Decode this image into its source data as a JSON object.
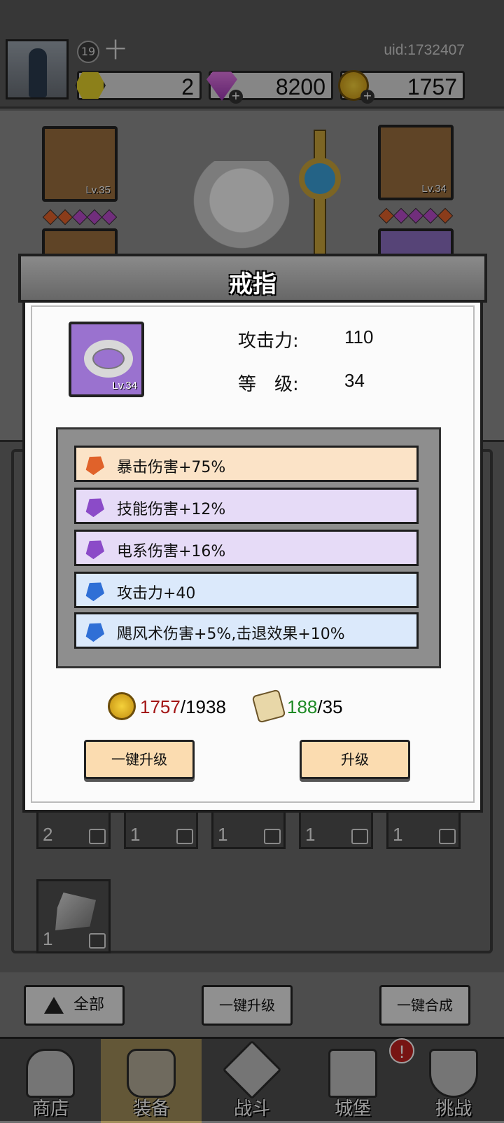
{
  "header": {
    "level": "19",
    "level_plus": "十",
    "uid": "uid:1732407",
    "resources": [
      {
        "icon": "hexagon-token-icon",
        "value": "2"
      },
      {
        "icon": "diamond-gem-icon",
        "value": "8200"
      },
      {
        "icon": "gold-coin-icon",
        "value": "1757"
      }
    ]
  },
  "equipment": {
    "left_slot_level": "Lv.35",
    "right_slot_level": "Lv.34"
  },
  "dialog": {
    "title": "戒指",
    "item_level": "Lv.34",
    "stats": [
      {
        "label": "攻击力:",
        "value": "110"
      },
      {
        "label": "等　级:",
        "value": "34"
      }
    ],
    "affixes": [
      {
        "text": "暴击伤害+75%",
        "gem_color": "#e0622a",
        "bg": "#fbe3c7"
      },
      {
        "text": "技能伤害+12%",
        "gem_color": "#8b4bc8",
        "bg": "#e6dbf7"
      },
      {
        "text": "电系伤害+16%",
        "gem_color": "#8b4bc8",
        "bg": "#e6dbf7"
      },
      {
        "text": "攻击力+40",
        "gem_color": "#2f6fd6",
        "bg": "#dbe9fb"
      },
      {
        "text": "飓风术伤害+5%,击退效果+10%",
        "gem_color": "#2f6fd6",
        "bg": "#dbe9fb"
      }
    ],
    "cost_gold": {
      "current": "1757",
      "sep_required": "/1938",
      "current_color": "#a31515"
    },
    "cost_scroll": {
      "current": "188",
      "sep_required": "/35",
      "current_color": "#1d8a24"
    },
    "btn_all_upgrade": "一键升级",
    "btn_upgrade": "升级"
  },
  "inventory": {
    "counts": [
      "2",
      "1",
      "1",
      "1",
      "1"
    ],
    "extra_count": "1"
  },
  "filter": {
    "all": "全部",
    "one_click_upgrade": "一键升级",
    "one_click_merge": "一键合成"
  },
  "nav": {
    "alert": "!",
    "items": [
      {
        "label": "商店"
      },
      {
        "label": "装备"
      },
      {
        "label": "战斗"
      },
      {
        "label": "城堡"
      },
      {
        "label": "挑战"
      }
    ]
  }
}
